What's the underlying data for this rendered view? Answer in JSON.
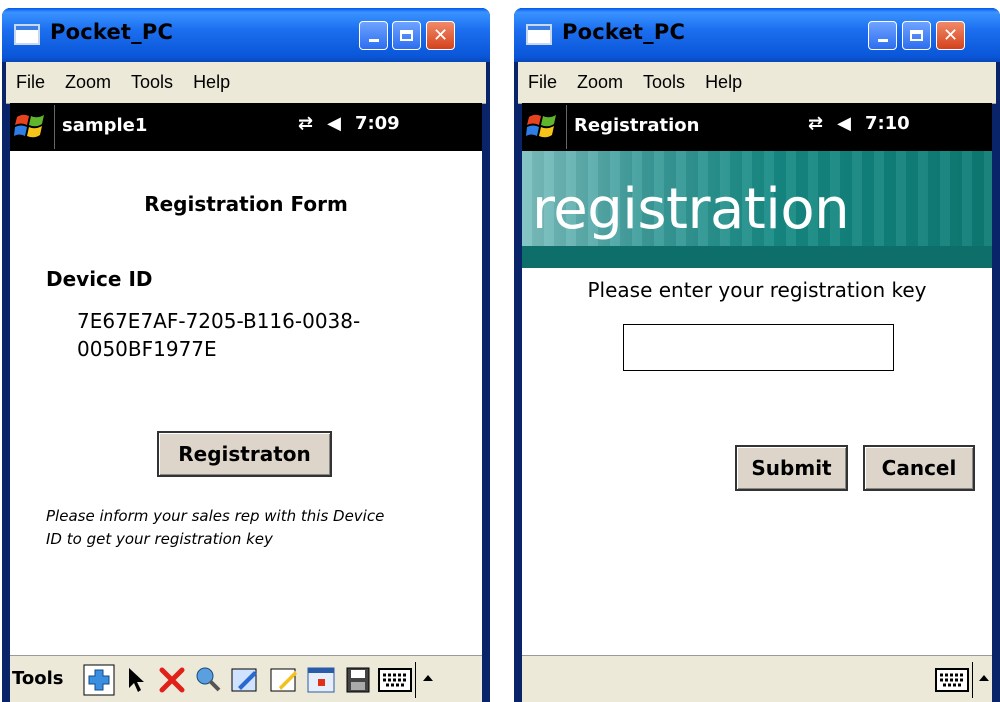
{
  "left": {
    "window_title": "Pocket_PC",
    "menu": [
      "File",
      "Zoom",
      "Tools",
      "Help"
    ],
    "task_title": "sample1",
    "time": "7:09",
    "form_title": "Registration Form",
    "device_id_label": "Device ID",
    "device_id_line1": "7E67E7AF-7205-B116-0038-",
    "device_id_line2": "0050BF1977E",
    "register_button": "Registraton",
    "note_line1": "Please inform your sales rep with this Device",
    "note_line2": "ID to get your registration key",
    "tools_label": "Tools"
  },
  "right": {
    "window_title": "Pocket_PC",
    "menu": [
      "File",
      "Zoom",
      "Tools",
      "Help"
    ],
    "task_title": "Registration",
    "time": "7:10",
    "banner_text": "registration",
    "prompt": "Please enter your registration key",
    "key_value": "",
    "submit_button": "Submit",
    "cancel_button": "Cancel"
  },
  "colors": {
    "titlebar_blue": "#0a56d8",
    "close_red": "#d4421c",
    "banner_teal": "#0e6e6a",
    "button_face": "#ddd5c9"
  },
  "icons": [
    "windows-start-flag-icon",
    "connectivity-arrows-icon",
    "speaker-icon",
    "plus-icon",
    "arrow-cursor-icon",
    "red-x-icon",
    "wrench-icon",
    "pen-icon",
    "highlighter-icon",
    "window-icon",
    "save-icon",
    "keyboard-icon",
    "up-triangle-icon"
  ]
}
